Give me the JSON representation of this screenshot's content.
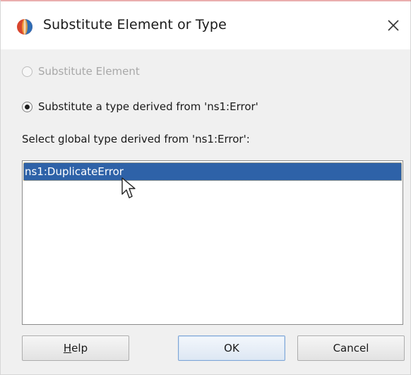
{
  "dialog": {
    "title": "Substitute Element or Type",
    "icon": "oracle-jdeveloper-icon",
    "close_label": "×"
  },
  "options": {
    "substitute_element_label": "Substitute Element",
    "substitute_element_enabled": false,
    "substitute_type_label": "Substitute a type derived from 'ns1:Error'",
    "selected": "substitute_type"
  },
  "list": {
    "label": "Select global type derived from 'ns1:Error':",
    "items": [
      "ns1:DuplicateError"
    ],
    "selected_index": 0
  },
  "buttons": {
    "help_mnemonic": "H",
    "help_rest": "elp",
    "ok_label": "OK",
    "cancel_label": "Cancel"
  },
  "colors": {
    "selection": "#2e62a8",
    "background": "#f0f0f0",
    "accent_border": "#7fa6d6"
  }
}
